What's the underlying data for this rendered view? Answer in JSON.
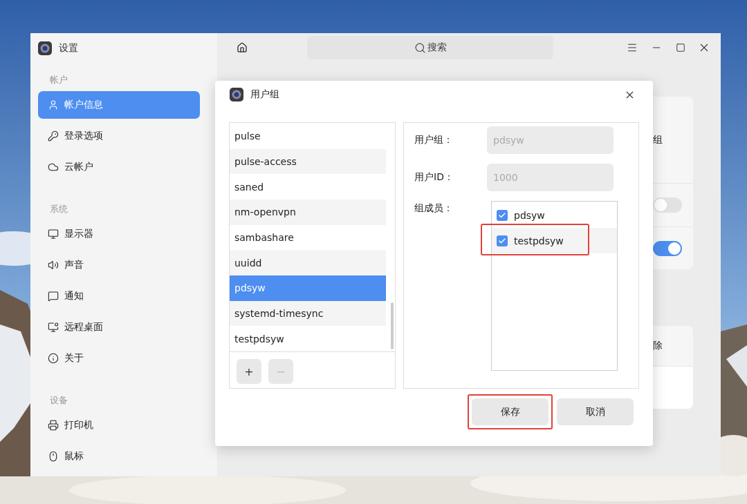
{
  "window": {
    "title": "设置"
  },
  "sidebar": {
    "sections": [
      {
        "label": "帐户",
        "items": [
          {
            "label": "帐户信息",
            "selected": true
          },
          {
            "label": "登录选项",
            "selected": false
          },
          {
            "label": "云帐户",
            "selected": false
          }
        ]
      },
      {
        "label": "系统",
        "items": [
          {
            "label": "显示器",
            "selected": false
          },
          {
            "label": "声音",
            "selected": false
          },
          {
            "label": "通知",
            "selected": false
          },
          {
            "label": "远程桌面",
            "selected": false
          },
          {
            "label": "关于",
            "selected": false
          }
        ]
      },
      {
        "label": "设备",
        "items": [
          {
            "label": "打印机",
            "selected": false
          },
          {
            "label": "鼠标",
            "selected": false
          }
        ]
      }
    ]
  },
  "toolbar": {
    "search": {
      "placeholder": "搜索"
    }
  },
  "background_cards": [
    {
      "rows": [
        {
          "kind": "text",
          "text": "组"
        },
        {
          "kind": "toggle",
          "on": false
        },
        {
          "kind": "toggle",
          "on": true
        }
      ]
    },
    {
      "rows": [
        {
          "kind": "text",
          "text": "除"
        },
        {
          "kind": "blank"
        }
      ]
    }
  ],
  "dialog": {
    "title": "用户组",
    "groups": [
      {
        "name": "pulse",
        "selected": false
      },
      {
        "name": "pulse-access",
        "selected": false
      },
      {
        "name": "saned",
        "selected": false
      },
      {
        "name": "nm-openvpn",
        "selected": false
      },
      {
        "name": "sambashare",
        "selected": false
      },
      {
        "name": "uuidd",
        "selected": false
      },
      {
        "name": "pdsyw",
        "selected": true
      },
      {
        "name": "systemd-timesync",
        "selected": false
      },
      {
        "name": "testpdsyw",
        "selected": false
      }
    ],
    "list_buttons": [
      {
        "label": "+",
        "disabled": false
      },
      {
        "label": "−",
        "disabled": true
      }
    ],
    "fields": [
      {
        "label": "用户组：",
        "value": "pdsyw"
      },
      {
        "label": "用户ID：",
        "value": "1000"
      }
    ],
    "members_label": "组成员：",
    "members": [
      {
        "name": "pdsyw",
        "checked": true,
        "highlighted": false
      },
      {
        "name": "testpdsyw",
        "checked": true,
        "highlighted": true
      }
    ],
    "buttons": [
      {
        "label": "保存",
        "highlighted": true
      },
      {
        "label": "取消",
        "highlighted": false
      }
    ]
  }
}
